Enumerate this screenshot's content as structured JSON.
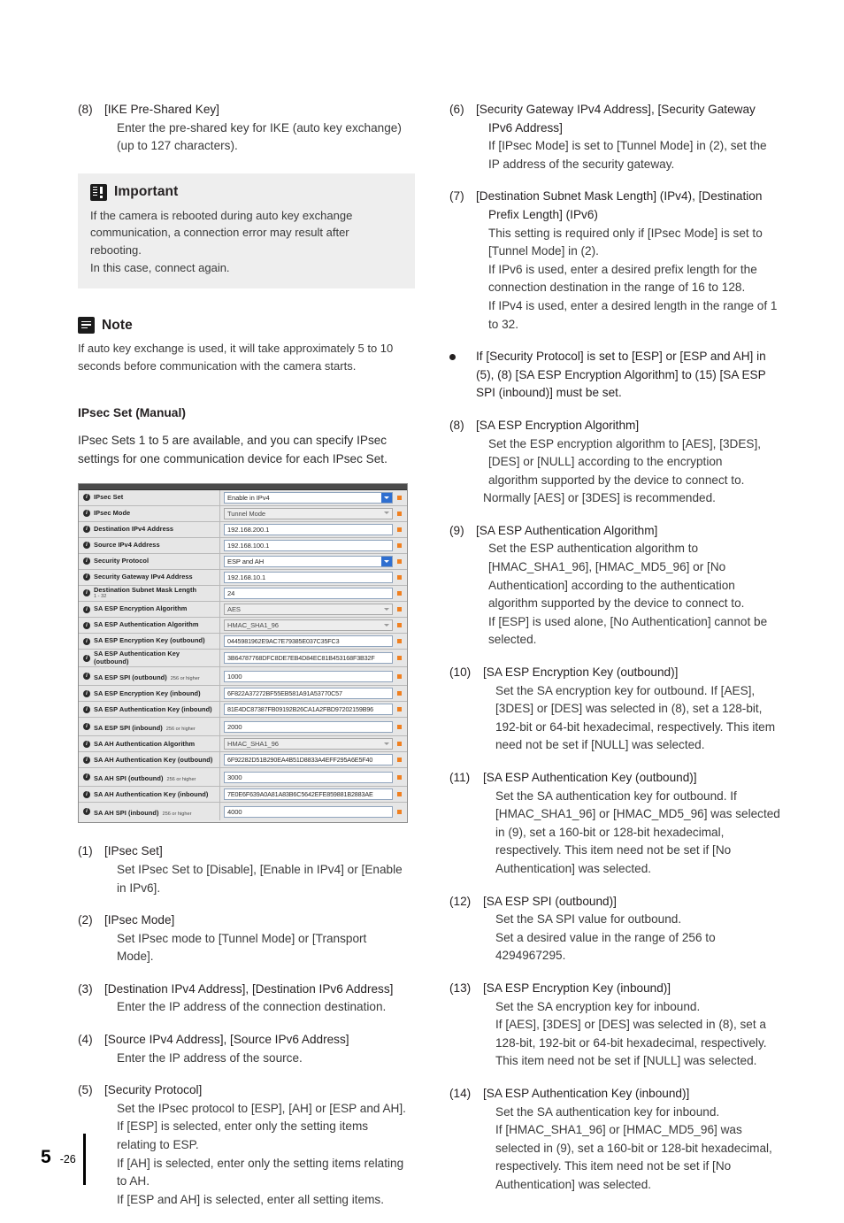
{
  "left_column": {
    "item8": {
      "num": "(8)",
      "head": "[IKE Pre-Shared Key]",
      "line1": "Enter the pre-shared key for IKE (auto key exchange)",
      "line2": "(up to 127 characters)."
    },
    "important": {
      "icon": "important-icon",
      "title": "Important",
      "line1": "If the camera is rebooted during auto key exchange",
      "line2": "communication, a connection error may result after rebooting.",
      "line3": "In this case, connect again."
    },
    "note": {
      "icon": "note-icon",
      "title": "Note",
      "line1": "If auto key exchange is used, it will take approximately 5 to 10",
      "line2": "seconds before communication with the camera starts."
    },
    "section_heading": "IPsec Set (Manual)",
    "section_intro_line1": "IPsec Sets 1 to 5 are available, and you can specify IPsec",
    "section_intro_line2": "settings for one communication device for each IPsec Set.",
    "item1": {
      "num": "(1)",
      "head": "[IPsec Set]",
      "line1": "Set IPsec Set to [Disable], [Enable in IPv4] or [Enable",
      "line2": "in IPv6]."
    },
    "item2": {
      "num": "(2)",
      "head": "[IPsec Mode]",
      "line1": "Set IPsec mode to [Tunnel Mode] or [Transport",
      "line2": "Mode]."
    },
    "item3": {
      "num": "(3)",
      "head": "[Destination IPv4 Address], [Destination IPv6 Address]",
      "line1": "Enter the IP address of the connection destination."
    },
    "item4": {
      "num": "(4)",
      "head": "[Source IPv4 Address], [Source IPv6 Address]",
      "line1": "Enter the IP address of the source."
    },
    "item5": {
      "num": "(5)",
      "head": "[Security Protocol]",
      "line1": "Set the IPsec protocol to [ESP], [AH] or [ESP and AH].",
      "line2": "If [ESP] is selected, enter only the setting items",
      "line3": "relating to ESP.",
      "line4": "If [AH] is selected, enter only the setting items relating",
      "line5": "to AH.",
      "line6": "If [ESP and AH] is selected, enter all setting items."
    }
  },
  "settings_screenshot": {
    "rows": [
      {
        "label": "IPsec Set",
        "sub": "",
        "value": "Enable in IPv4",
        "control": "dropdown-active",
        "required": true
      },
      {
        "label": "IPsec Mode",
        "sub": "",
        "value": "Tunnel Mode",
        "control": "dropdown-disabled",
        "required": true
      },
      {
        "label": "Destination IPv4 Address",
        "sub": "",
        "value": "192.168.200.1",
        "control": "text",
        "required": true
      },
      {
        "label": "Source IPv4 Address",
        "sub": "",
        "value": "192.168.100.1",
        "control": "text",
        "required": true
      },
      {
        "label": "Security Protocol",
        "sub": "",
        "value": "ESP and AH",
        "control": "dropdown-active",
        "required": true
      },
      {
        "label": "Security Gateway IPv4 Address",
        "sub": "",
        "value": "192.168.10.1",
        "control": "text",
        "required": true
      },
      {
        "label": "Destination Subnet Mask Length",
        "sub": "1 - 32",
        "value": "24",
        "control": "text",
        "required": true
      },
      {
        "label": "SA ESP Encryption Algorithm",
        "sub": "",
        "value": "AES",
        "control": "dropdown-disabled",
        "required": true
      },
      {
        "label": "SA ESP Authentication Algorithm",
        "sub": "",
        "value": "HMAC_SHA1_96",
        "control": "dropdown-disabled",
        "required": true
      },
      {
        "label": "SA ESP Encryption Key (outbound)",
        "sub": "",
        "value": "0445981962E9AC7E79385E037C35FC3",
        "control": "hex",
        "required": true
      },
      {
        "label": "SA ESP Authentication Key (outbound)",
        "sub": "",
        "value": "3B64787768DFC8DE7EB4D84EC81B453168F3B32F",
        "control": "hex",
        "required": true
      },
      {
        "label": "SA ESP SPI (outbound)",
        "sub": "256 or higher",
        "value": "1000",
        "control": "text",
        "required": true
      },
      {
        "label": "SA ESP Encryption Key (inbound)",
        "sub": "",
        "value": "6F822A37272BF55EB581A91A53770C57",
        "control": "hex",
        "required": true
      },
      {
        "label": "SA ESP Authentication Key (inbound)",
        "sub": "",
        "value": "81E4DC87387FB09192B26CA1A2FBD97202159B96",
        "control": "hex",
        "required": true
      },
      {
        "label": "SA ESP SPI (inbound)",
        "sub": "256 or higher",
        "value": "2000",
        "control": "text",
        "required": true
      },
      {
        "label": "SA AH Authentication Algorithm",
        "sub": "",
        "value": "HMAC_SHA1_96",
        "control": "dropdown-disabled",
        "required": true
      },
      {
        "label": "SA AH Authentication Key (outbound)",
        "sub": "",
        "value": "6F92282D51B290EA4B51D8833A4EFF295A6E5F40",
        "control": "hex",
        "required": true
      },
      {
        "label": "SA AH SPI (outbound)",
        "sub": "256 or higher",
        "value": "3000",
        "control": "text",
        "required": true
      },
      {
        "label": "SA AH Authentication Key (inbound)",
        "sub": "",
        "value": "7E0E6F639A0A81A83B6C5642EFE859881B2883AE",
        "control": "hex",
        "required": true
      },
      {
        "label": "SA AH SPI (inbound)",
        "sub": "256 or higher",
        "value": "4000",
        "control": "text",
        "required": true
      }
    ]
  },
  "right_column": {
    "item6": {
      "num": "(6)",
      "head_line1": "[Security Gateway IPv4 Address], [Security Gateway",
      "head_line2": "IPv6 Address]",
      "line1": "If [IPsec Mode] is set to [Tunnel Mode] in (2), set the",
      "line2": "IP address of the security gateway."
    },
    "item7": {
      "num": "(7)",
      "head_line1": "[Destination Subnet Mask Length] (IPv4), [Destination",
      "head_line2": "Prefix Length] (IPv6)",
      "line1": "This setting is required only if [IPsec Mode] is set to",
      "line2": "[Tunnel Mode] in (2).",
      "line3": "If IPv6 is used, enter a desired prefix length for the",
      "line4": "connection destination in the range of 16 to 128.",
      "line5": "If IPv4 is used, enter a desired length in the range of 1",
      "line6": "to 32."
    },
    "bullet": {
      "line1": "If [Security Protocol] is set to [ESP] or [ESP and AH] in",
      "line2": "(5), (8) [SA ESP Encryption Algorithm] to (15) [SA ESP",
      "line3": "SPI (inbound)] must be set."
    },
    "item8": {
      "num": "(8)",
      "head": "[SA ESP Encryption Algorithm]",
      "line1": "Set the ESP encryption algorithm to [AES], [3DES],",
      "line2": "[DES] or [NULL] according to the encryption",
      "line3": "algorithm supported by the device to connect to.",
      "line4": "Normally [AES] or [3DES] is recommended."
    },
    "item9": {
      "num": "(9)",
      "head": "[SA ESP Authentication Algorithm]",
      "line1": "Set the ESP authentication algorithm to",
      "line2": "[HMAC_SHA1_96], [HMAC_MD5_96] or [No",
      "line3": "Authentication] according to the authentication",
      "line4": "algorithm supported by the device to connect to.",
      "line5": "If [ESP] is used alone, [No Authentication] cannot be",
      "line6": "selected."
    },
    "item10": {
      "num": "(10)",
      "head": "[SA ESP Encryption Key (outbound)]",
      "line1": "Set the SA encryption key for outbound. If [AES],",
      "line2": "[3DES] or [DES] was selected in (8), set a 128-bit,",
      "line3": "192-bit or 64-bit hexadecimal, respectively. This item",
      "line4": "need not be set if [NULL] was selected."
    },
    "item11": {
      "num": "(11)",
      "head": "[SA ESP Authentication Key (outbound)]",
      "line1": "Set the SA authentication key for outbound. If",
      "line2": "[HMAC_SHA1_96] or [HMAC_MD5_96] was selected",
      "line3": "in (9), set a 160-bit or 128-bit hexadecimal,",
      "line4": "respectively. This item need not be set if [No",
      "line5": "Authentication] was selected."
    },
    "item12": {
      "num": "(12)",
      "head": "[SA ESP SPI (outbound)]",
      "line1": "Set the SA SPI value for outbound.",
      "line2": "Set a desired value in the range of 256 to",
      "line3": "4294967295."
    },
    "item13": {
      "num": "(13)",
      "head": "[SA ESP Encryption Key (inbound)]",
      "line1": "Set the SA encryption key for inbound.",
      "line2": "If [AES], [3DES] or [DES] was selected in (8), set a",
      "line3": "128-bit, 192-bit or 64-bit hexadecimal, respectively.",
      "line4": "This item need not be set if [NULL] was selected."
    },
    "item14": {
      "num": "(14)",
      "head": "[SA ESP Authentication Key (inbound)]",
      "line1": "Set the SA authentication key for inbound.",
      "line2": "If [HMAC_SHA1_96] or [HMAC_MD5_96] was",
      "line3": "selected in (9), set a 160-bit or 128-bit hexadecimal,",
      "line4": "respectively. This item need not be set if [No",
      "line5": "Authentication] was selected."
    }
  },
  "footer": {
    "chapter": "5",
    "page": "-26"
  }
}
